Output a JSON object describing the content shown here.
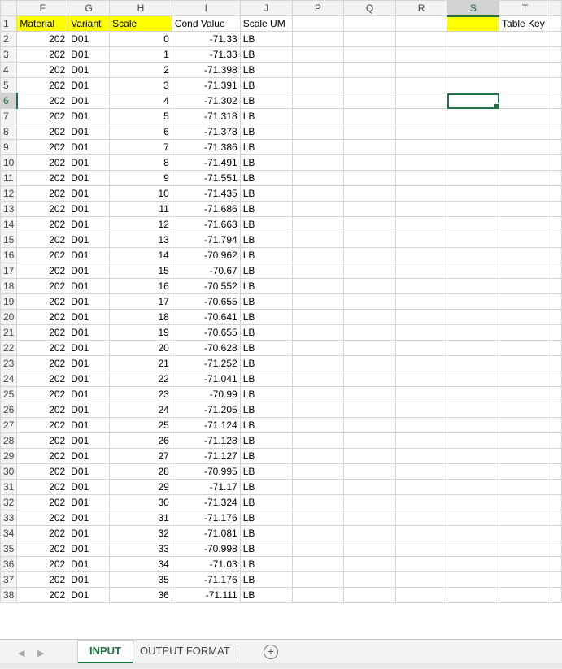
{
  "columns": [
    "F",
    "G",
    "H",
    "I",
    "J",
    "P",
    "Q",
    "R",
    "S",
    "T"
  ],
  "selected_column": "S",
  "selected_row": 6,
  "header_row": {
    "row": 1,
    "material": "Material",
    "variant": "Variant",
    "scale": "Scale",
    "cond_value": "Cond Value",
    "scale_um": "Scale UM",
    "table_key": "Table Key"
  },
  "highlight_color": "#ffff00",
  "accent_color": "#217346",
  "rows": [
    {
      "row": 2,
      "material": "202",
      "variant": "D01",
      "scale": "0",
      "cond_value": "-71.33",
      "scale_um": "LB"
    },
    {
      "row": 3,
      "material": "202",
      "variant": "D01",
      "scale": "1",
      "cond_value": "-71.33",
      "scale_um": "LB"
    },
    {
      "row": 4,
      "material": "202",
      "variant": "D01",
      "scale": "2",
      "cond_value": "-71.398",
      "scale_um": "LB"
    },
    {
      "row": 5,
      "material": "202",
      "variant": "D01",
      "scale": "3",
      "cond_value": "-71.391",
      "scale_um": "LB"
    },
    {
      "row": 6,
      "material": "202",
      "variant": "D01",
      "scale": "4",
      "cond_value": "-71.302",
      "scale_um": "LB"
    },
    {
      "row": 7,
      "material": "202",
      "variant": "D01",
      "scale": "5",
      "cond_value": "-71.318",
      "scale_um": "LB"
    },
    {
      "row": 8,
      "material": "202",
      "variant": "D01",
      "scale": "6",
      "cond_value": "-71.378",
      "scale_um": "LB"
    },
    {
      "row": 9,
      "material": "202",
      "variant": "D01",
      "scale": "7",
      "cond_value": "-71.386",
      "scale_um": "LB"
    },
    {
      "row": 10,
      "material": "202",
      "variant": "D01",
      "scale": "8",
      "cond_value": "-71.491",
      "scale_um": "LB"
    },
    {
      "row": 11,
      "material": "202",
      "variant": "D01",
      "scale": "9",
      "cond_value": "-71.551",
      "scale_um": "LB"
    },
    {
      "row": 12,
      "material": "202",
      "variant": "D01",
      "scale": "10",
      "cond_value": "-71.435",
      "scale_um": "LB"
    },
    {
      "row": 13,
      "material": "202",
      "variant": "D01",
      "scale": "11",
      "cond_value": "-71.686",
      "scale_um": "LB"
    },
    {
      "row": 14,
      "material": "202",
      "variant": "D01",
      "scale": "12",
      "cond_value": "-71.663",
      "scale_um": "LB"
    },
    {
      "row": 15,
      "material": "202",
      "variant": "D01",
      "scale": "13",
      "cond_value": "-71.794",
      "scale_um": "LB"
    },
    {
      "row": 16,
      "material": "202",
      "variant": "D01",
      "scale": "14",
      "cond_value": "-70.962",
      "scale_um": "LB"
    },
    {
      "row": 17,
      "material": "202",
      "variant": "D01",
      "scale": "15",
      "cond_value": "-70.67",
      "scale_um": "LB"
    },
    {
      "row": 18,
      "material": "202",
      "variant": "D01",
      "scale": "16",
      "cond_value": "-70.552",
      "scale_um": "LB"
    },
    {
      "row": 19,
      "material": "202",
      "variant": "D01",
      "scale": "17",
      "cond_value": "-70.655",
      "scale_um": "LB"
    },
    {
      "row": 20,
      "material": "202",
      "variant": "D01",
      "scale": "18",
      "cond_value": "-70.641",
      "scale_um": "LB"
    },
    {
      "row": 21,
      "material": "202",
      "variant": "D01",
      "scale": "19",
      "cond_value": "-70.655",
      "scale_um": "LB"
    },
    {
      "row": 22,
      "material": "202",
      "variant": "D01",
      "scale": "20",
      "cond_value": "-70.628",
      "scale_um": "LB"
    },
    {
      "row": 23,
      "material": "202",
      "variant": "D01",
      "scale": "21",
      "cond_value": "-71.252",
      "scale_um": "LB"
    },
    {
      "row": 24,
      "material": "202",
      "variant": "D01",
      "scale": "22",
      "cond_value": "-71.041",
      "scale_um": "LB"
    },
    {
      "row": 25,
      "material": "202",
      "variant": "D01",
      "scale": "23",
      "cond_value": "-70.99",
      "scale_um": "LB"
    },
    {
      "row": 26,
      "material": "202",
      "variant": "D01",
      "scale": "24",
      "cond_value": "-71.205",
      "scale_um": "LB"
    },
    {
      "row": 27,
      "material": "202",
      "variant": "D01",
      "scale": "25",
      "cond_value": "-71.124",
      "scale_um": "LB"
    },
    {
      "row": 28,
      "material": "202",
      "variant": "D01",
      "scale": "26",
      "cond_value": "-71.128",
      "scale_um": "LB"
    },
    {
      "row": 29,
      "material": "202",
      "variant": "D01",
      "scale": "27",
      "cond_value": "-71.127",
      "scale_um": "LB"
    },
    {
      "row": 30,
      "material": "202",
      "variant": "D01",
      "scale": "28",
      "cond_value": "-70.995",
      "scale_um": "LB"
    },
    {
      "row": 31,
      "material": "202",
      "variant": "D01",
      "scale": "29",
      "cond_value": "-71.17",
      "scale_um": "LB"
    },
    {
      "row": 32,
      "material": "202",
      "variant": "D01",
      "scale": "30",
      "cond_value": "-71.324",
      "scale_um": "LB"
    },
    {
      "row": 33,
      "material": "202",
      "variant": "D01",
      "scale": "31",
      "cond_value": "-71.176",
      "scale_um": "LB"
    },
    {
      "row": 34,
      "material": "202",
      "variant": "D01",
      "scale": "32",
      "cond_value": "-71.081",
      "scale_um": "LB"
    },
    {
      "row": 35,
      "material": "202",
      "variant": "D01",
      "scale": "33",
      "cond_value": "-70.998",
      "scale_um": "LB"
    },
    {
      "row": 36,
      "material": "202",
      "variant": "D01",
      "scale": "34",
      "cond_value": "-71.03",
      "scale_um": "LB"
    },
    {
      "row": 37,
      "material": "202",
      "variant": "D01",
      "scale": "35",
      "cond_value": "-71.176",
      "scale_um": "LB"
    },
    {
      "row": 38,
      "material": "202",
      "variant": "D01",
      "scale": "36",
      "cond_value": "-71.111",
      "scale_um": "LB"
    }
  ],
  "tabs": [
    {
      "label": "INPUT",
      "active": true
    },
    {
      "label": "OUTPUT FORMAT",
      "active": false
    }
  ],
  "add_sheet_symbol": "+",
  "nav_left_icon": "◀",
  "nav_right_icon": "▶"
}
